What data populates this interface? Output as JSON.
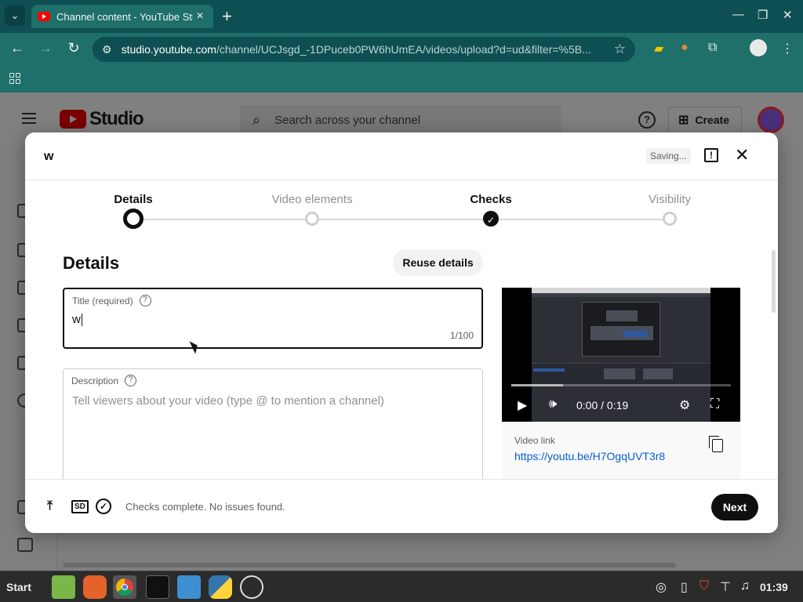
{
  "browser": {
    "tab_title": "Channel content - YouTube Studio",
    "new_tab": "+",
    "url_host": "studio.youtube.com",
    "url_path": "/channel/UCJsgd_-1DPuceb0PW6hUmEA/videos/upload?d=ud&filter=%5B..."
  },
  "studio": {
    "logo_text": "Studio",
    "search_placeholder": "Search across your channel",
    "create_label": "Create"
  },
  "dialog": {
    "title": "w",
    "saving_label": "Saving...",
    "steps": [
      {
        "label": "Details"
      },
      {
        "label": "Video elements"
      },
      {
        "label": "Checks"
      },
      {
        "label": "Visibility"
      }
    ],
    "section_title": "Details",
    "reuse_label": "Reuse details",
    "title_field": {
      "label": "Title (required)",
      "value": "w",
      "counter": "1/100"
    },
    "description_field": {
      "label": "Description",
      "placeholder": "Tell viewers about your video (type @ to mention a channel)"
    },
    "video": {
      "time": "0:00 / 0:19",
      "link_label": "Video link",
      "link": "https://youtu.be/H7OgqUVT3r8"
    },
    "footer": {
      "status": "Checks complete. No issues found.",
      "next_label": "Next"
    }
  },
  "taskbar": {
    "start_label": "Start",
    "clock": "01:39"
  },
  "colors": {
    "brand": "#ff0000",
    "link": "#065fd4",
    "browser_frame": "#1f6f6a"
  }
}
